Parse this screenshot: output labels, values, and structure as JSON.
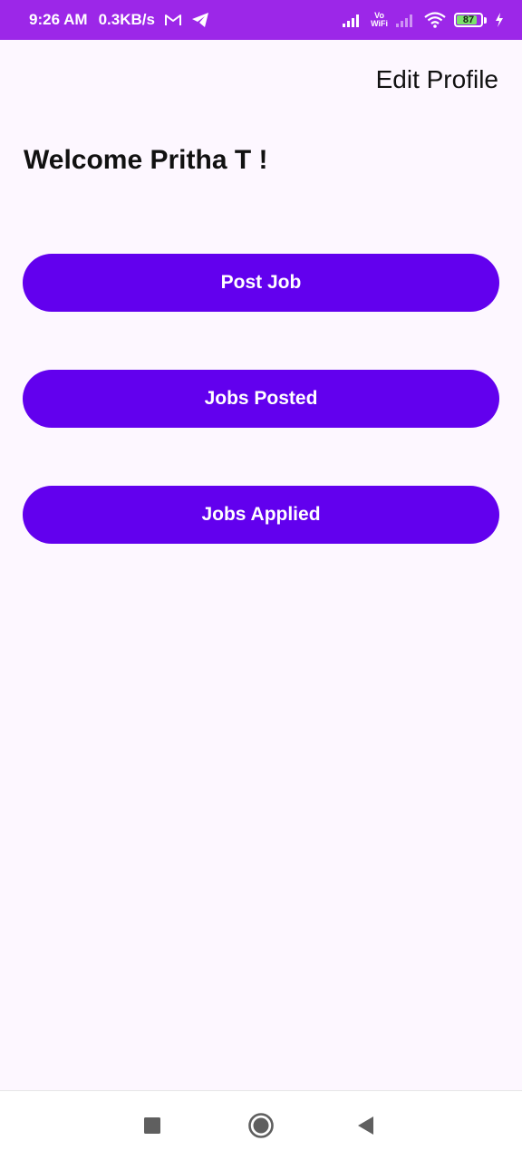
{
  "status_bar": {
    "time": "9:26 AM",
    "net_speed": "0.3KB/s",
    "battery_level": "87",
    "battery_percent": 87,
    "background_color": "#9c27e8",
    "icons": [
      "gmail-icon",
      "telegram-icon",
      "signal-icon",
      "vowifi-icon",
      "signal-weak-icon",
      "wifi-icon",
      "battery-icon",
      "charging-icon"
    ],
    "vowifi_top": "Vo",
    "vowifi_bottom": "WiFi"
  },
  "header": {
    "edit_profile_label": "Edit Profile"
  },
  "main": {
    "welcome_text": "Welcome Pritha T !",
    "buttons": {
      "post_job": "Post Job",
      "jobs_posted": "Jobs Posted",
      "jobs_applied": "Jobs Applied"
    },
    "button_color": "#6200ee",
    "background_color": "#fdf7ff"
  },
  "nav_bar": {
    "icons": [
      "recents-square-icon",
      "home-circle-icon",
      "back-triangle-icon"
    ]
  }
}
